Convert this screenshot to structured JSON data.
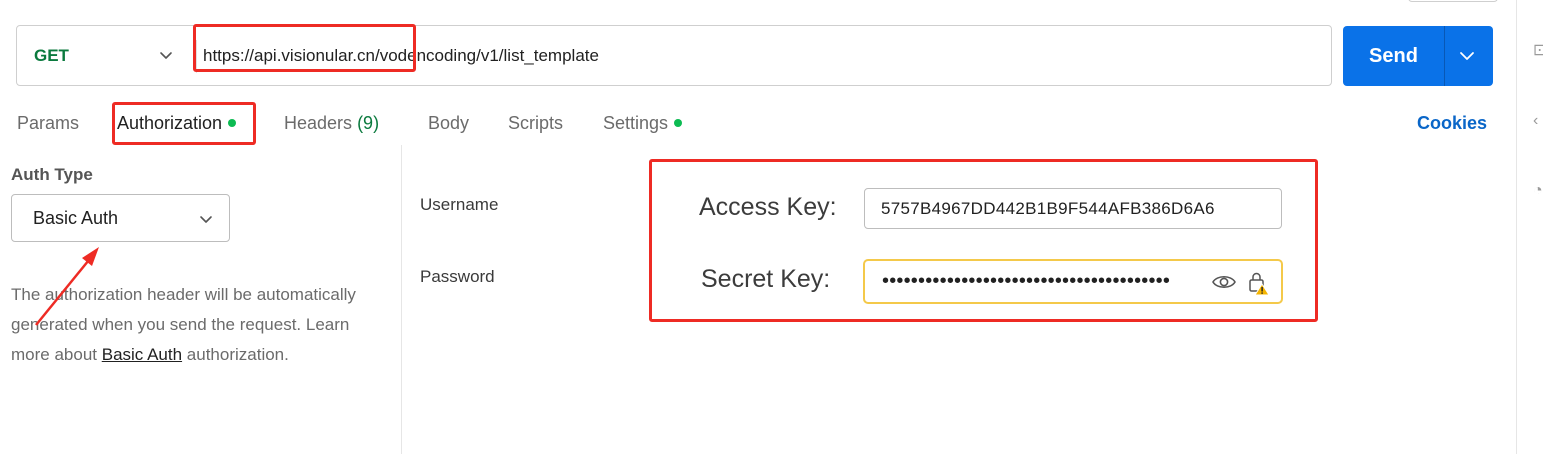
{
  "request": {
    "method": "GET",
    "url": "https://api.visionular.cn/vodencoding/v1/list_template",
    "send_label": "Send"
  },
  "tabs": [
    {
      "label": "Params"
    },
    {
      "label": "Authorization",
      "dot": true
    },
    {
      "label": "Headers",
      "count": "(9)"
    },
    {
      "label": "Body"
    },
    {
      "label": "Scripts"
    },
    {
      "label": "Settings",
      "dot": true
    }
  ],
  "cookies_label": "Cookies",
  "auth": {
    "type_label": "Auth Type",
    "selected": "Basic Auth",
    "description_pre": "The authorization header will be automatically generated when you send the request. Learn more about ",
    "description_link": "Basic Auth",
    "description_post": " authorization."
  },
  "fields": {
    "username_label": "Username",
    "password_label": "Password",
    "access_key_label": "Access Key:",
    "access_key_value": "5757B4967DD442B1B9F544AFB386D6A6",
    "secret_key_label": "Secret Key:",
    "secret_key_mask": "••••••••••••••••••••••••••••••••••••••••"
  },
  "colors": {
    "send": "#0a72e8",
    "method": "#0b7a3e",
    "annotation": "#ee2b24",
    "warning_border": "#f4c94a",
    "active_dot": "#0cbb52",
    "link": "#0a66c8"
  },
  "icons": [
    "chevron-down-icon",
    "eye-icon",
    "lock-warning-icon",
    "arrow-annotation"
  ]
}
